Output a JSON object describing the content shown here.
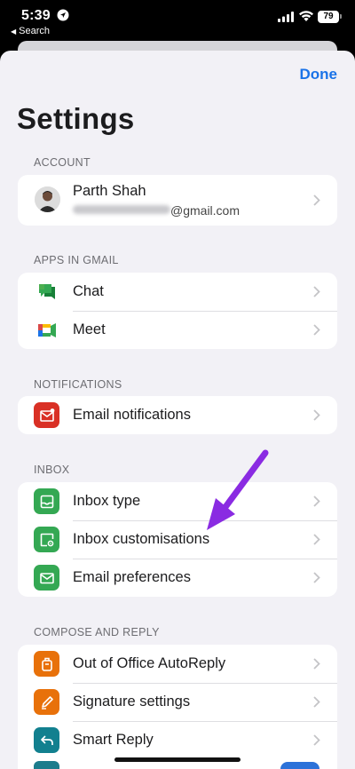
{
  "status_bar": {
    "time": "5:39",
    "back_label": "Search",
    "battery": "79"
  },
  "header": {
    "done_label": "Done",
    "title": "Settings"
  },
  "account": {
    "header": "ACCOUNT",
    "name": "Parth Shah",
    "email_suffix": "@gmail.com"
  },
  "apps": {
    "header": "APPS IN GMAIL",
    "items": [
      {
        "label": "Chat",
        "icon": "google-chat-icon"
      },
      {
        "label": "Meet",
        "icon": "google-meet-icon"
      }
    ]
  },
  "notifications": {
    "header": "NOTIFICATIONS",
    "items": [
      {
        "label": "Email notifications",
        "icon": "mail-badge-icon",
        "color": "#d93025"
      }
    ]
  },
  "inbox": {
    "header": "INBOX",
    "items": [
      {
        "label": "Inbox type",
        "icon": "inbox-tray-icon",
        "color": "#34a853"
      },
      {
        "label": "Inbox customisations",
        "icon": "inbox-settings-icon",
        "color": "#34a853"
      },
      {
        "label": "Email preferences",
        "icon": "envelope-icon",
        "color": "#34a853"
      }
    ]
  },
  "compose": {
    "header": "COMPOSE AND REPLY",
    "items": [
      {
        "label": "Out of Office AutoReply",
        "icon": "suitcase-icon",
        "color": "#e8710a"
      },
      {
        "label": "Signature settings",
        "icon": "pen-icon",
        "color": "#e8710a"
      },
      {
        "label": "Smart Reply",
        "icon": "reply-icon",
        "color": "#12808f"
      }
    ]
  },
  "colors": {
    "accent": "#1a73e8",
    "annotation_arrow": "#8a2be2"
  }
}
